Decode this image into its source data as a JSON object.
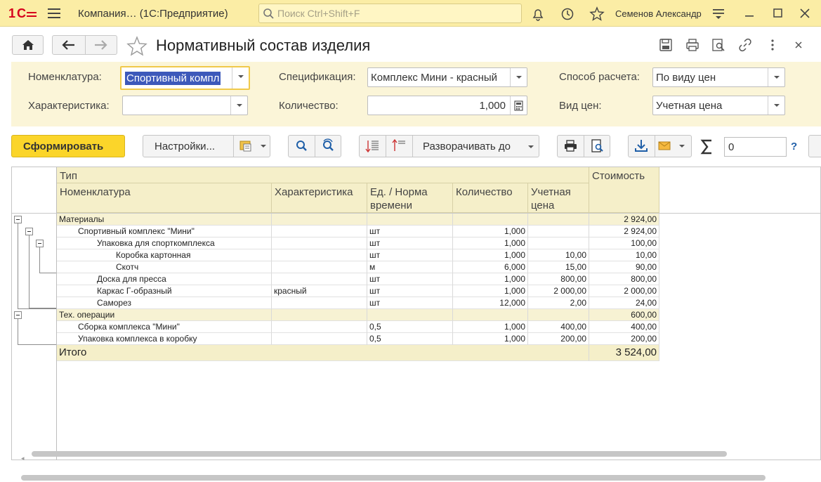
{
  "app": {
    "logo": "1С",
    "title": "Компания…  (1С:Предприятие)",
    "search_placeholder": "Поиск Ctrl+Shift+F",
    "user": "Семенов Александр"
  },
  "form": {
    "title": "Нормативный состав изделия"
  },
  "params": {
    "nomenclature_label": "Номенклатура:",
    "nomenclature_value": "Спортивный компл",
    "characteristic_label": "Характеристика:",
    "characteristic_value": "",
    "spec_label": "Спецификация:",
    "spec_value": "Комплекс Мини - красный",
    "qty_label": "Количество:",
    "qty_value": "1,000",
    "calc_label": "Способ расчета:",
    "calc_value": "По виду цен",
    "price_label": "Вид цен:",
    "price_value": "Учетная цена"
  },
  "toolbar": {
    "generate": "Сформировать",
    "settings": "Настройки...",
    "expand": "Разворачивать до",
    "sum_value": "0",
    "help": "?"
  },
  "report": {
    "headers": {
      "type": "Тип",
      "nomenclature": "Номенклатура",
      "characteristic": "Характеристика",
      "unit": "Ед. / Норма времени",
      "qty": "Количество",
      "price": "Учетная цена",
      "cost": "Стоимость"
    },
    "rows": [
      {
        "name": "Материалы",
        "char": "",
        "unit": "",
        "qty": "",
        "price": "",
        "cost": "2 924,00",
        "level": 0,
        "group": true
      },
      {
        "name": "Спортивный комплекс \"Мини\"",
        "char": "",
        "unit": "шт",
        "qty": "1,000",
        "price": "",
        "cost": "2 924,00",
        "level": 1,
        "group": false
      },
      {
        "name": "Упаковка для спорткомплекса",
        "char": "",
        "unit": "шт",
        "qty": "1,000",
        "price": "",
        "cost": "100,00",
        "level": 2,
        "group": false
      },
      {
        "name": "Коробка картонная",
        "char": "",
        "unit": "шт",
        "qty": "1,000",
        "price": "10,00",
        "cost": "10,00",
        "level": 3,
        "group": false
      },
      {
        "name": "Скотч",
        "char": "",
        "unit": "м",
        "qty": "6,000",
        "price": "15,00",
        "cost": "90,00",
        "level": 3,
        "group": false
      },
      {
        "name": "Доска для пресса",
        "char": "",
        "unit": "шт",
        "qty": "1,000",
        "price": "800,00",
        "cost": "800,00",
        "level": 2,
        "group": false
      },
      {
        "name": "Каркас Г-образный",
        "char": "красный",
        "unit": "шт",
        "qty": "1,000",
        "price": "2 000,00",
        "cost": "2 000,00",
        "level": 2,
        "group": false
      },
      {
        "name": "Саморез",
        "char": "",
        "unit": "шт",
        "qty": "12,000",
        "price": "2,00",
        "cost": "24,00",
        "level": 2,
        "group": false
      },
      {
        "name": "Тех. операции",
        "char": "",
        "unit": "",
        "qty": "",
        "price": "",
        "cost": "600,00",
        "level": 0,
        "group": true
      },
      {
        "name": "Сборка комплекса \"Мини\"",
        "char": "",
        "unit": "0,5",
        "qty": "1,000",
        "price": "400,00",
        "cost": "400,00",
        "level": 1,
        "group": false
      },
      {
        "name": "Упаковка комплекса в коробку",
        "char": "",
        "unit": "0,5",
        "qty": "1,000",
        "price": "200,00",
        "cost": "200,00",
        "level": 1,
        "group": false
      }
    ],
    "total_label": "Итого",
    "total_value": "3 524,00"
  }
}
